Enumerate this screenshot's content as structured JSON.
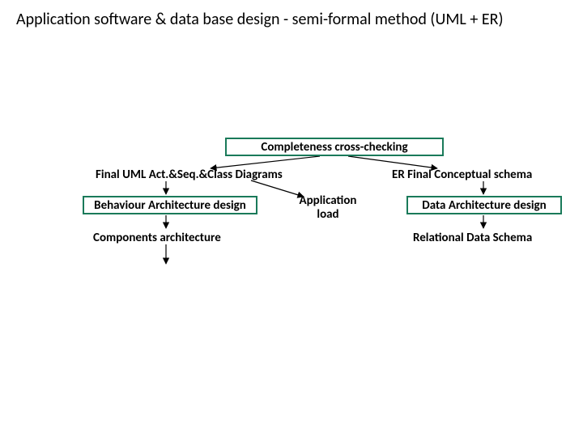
{
  "title": "Application software & data base design - semi-formal method (UML + ER)",
  "nodes": {
    "completeness": "Completeness cross-checking",
    "uml_final": "Final UML Act.&Seq.&Class Diagrams",
    "er_final": "ER Final Conceptual schema",
    "behaviour": "Behaviour Architecture design",
    "app_load_line1": "Application",
    "app_load_line2": "load",
    "data_arch": "Data Architecture design",
    "components": "Components architecture",
    "relational": "Relational Data Schema"
  }
}
